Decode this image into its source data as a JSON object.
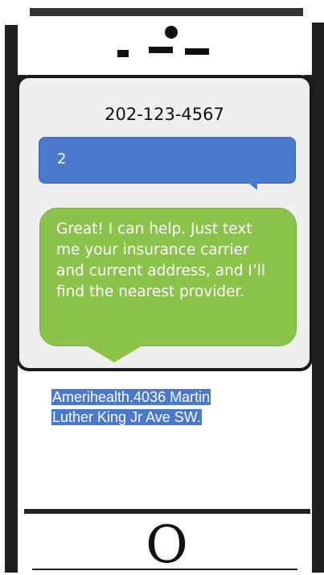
{
  "screen": {
    "header": {
      "phone_number": "202-123-4567"
    },
    "messages": [
      {
        "sender": "user",
        "text": "2",
        "color": "#4a79cc"
      },
      {
        "sender": "bot",
        "text": "Great! I can help. Just text me your insurance carrier and current address, and I’ll find the nearest provider.",
        "color": "#8bc34a"
      }
    ]
  },
  "composer": {
    "typed_line1": "Amerihealth.4036  Martin",
    "typed_line2": "Luther  King Jr Ave SW.",
    "highlight_color": "#4a79cc"
  },
  "device": {
    "home_button_glyph": "O"
  }
}
